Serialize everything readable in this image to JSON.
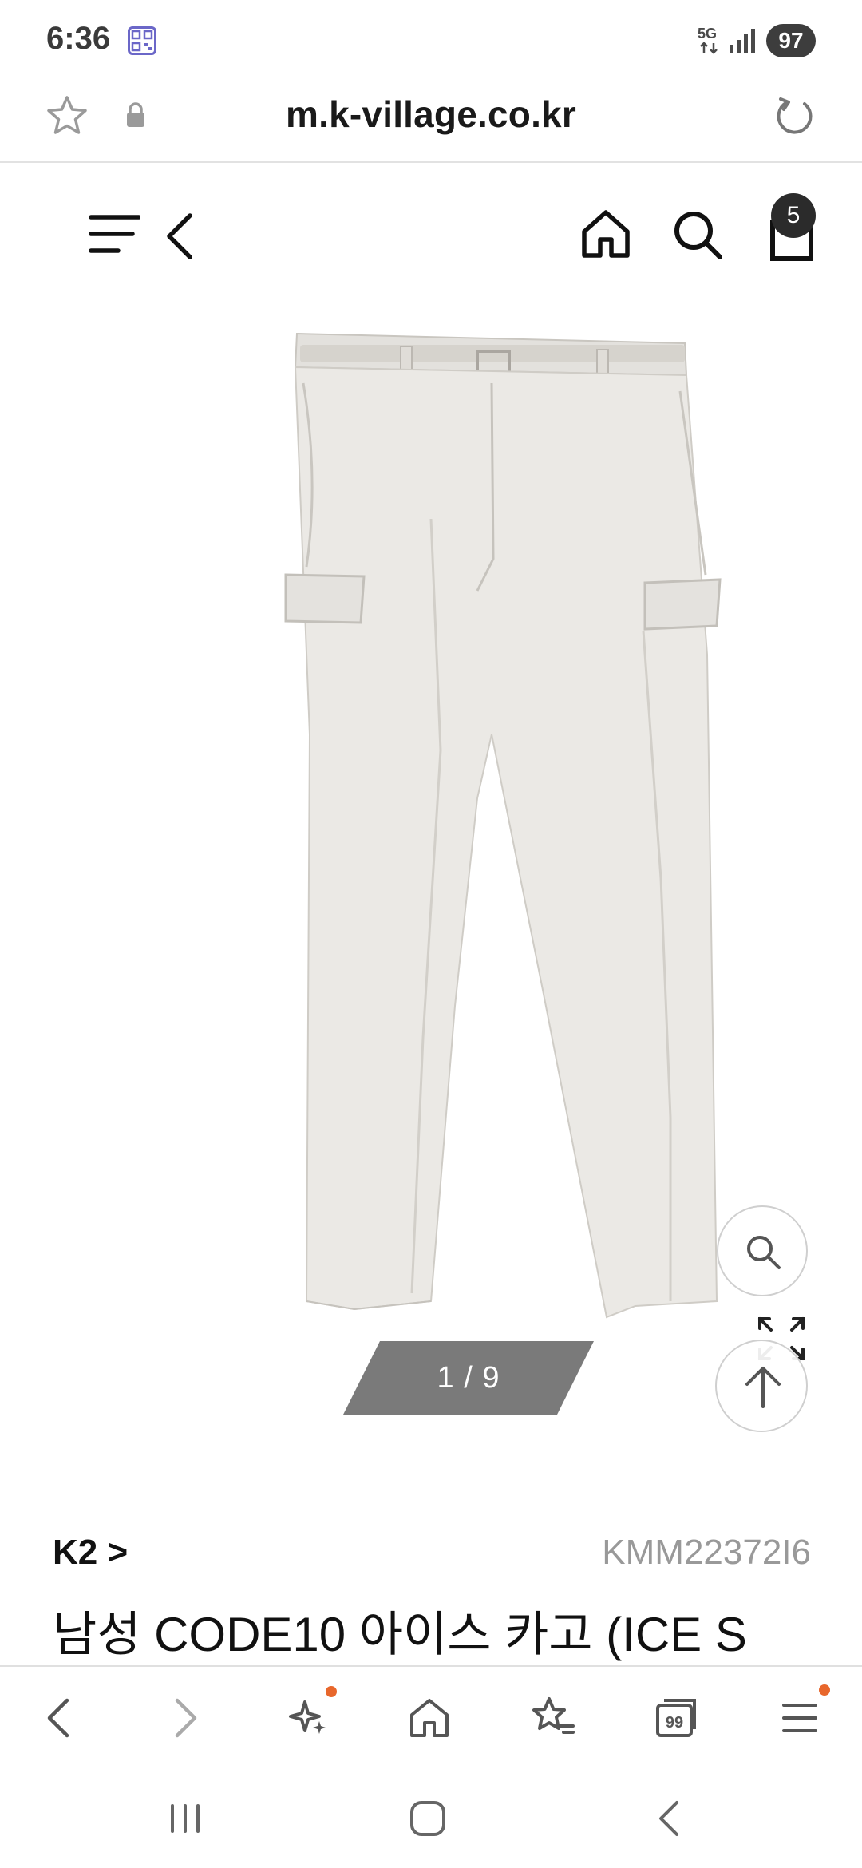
{
  "status_bar": {
    "time": "6:36",
    "network": "5G",
    "battery": "97",
    "icons": [
      "qr-code-icon",
      "signal-icon",
      "battery-icon"
    ]
  },
  "browser": {
    "url": "m.k-village.co.kr",
    "icons": [
      "star-icon",
      "lock-icon",
      "reload-icon"
    ]
  },
  "site_header": {
    "cart_count": "5",
    "icons": [
      "menu-icon",
      "back-icon",
      "home-icon",
      "search-icon",
      "cart-icon"
    ]
  },
  "gallery": {
    "pager": "1 / 9",
    "image_alt": "white cargo pants with belt"
  },
  "product": {
    "brand": "K2 >",
    "code": "KMM22372I6",
    "title": "남성 CODE10 아이스 카고 (ICE S"
  },
  "toolbar": {
    "items": [
      "back-icon",
      "forward-icon",
      "sparkle-icon",
      "home-icon",
      "bookmarks-icon",
      "tabs-icon",
      "menu-icon"
    ],
    "tabs_count": "99"
  },
  "colors": {
    "accent_dot": "#e8672c",
    "pager_bg": "#7a7a7a",
    "badge_bg": "#2b2b2b"
  }
}
